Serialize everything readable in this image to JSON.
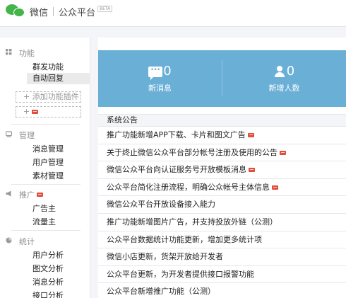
{
  "header": {
    "brand": "微信",
    "platform": "公众平台",
    "beta": "BETA"
  },
  "sidebar": {
    "sections": [
      {
        "title": "功能",
        "icon": "grid-icon",
        "items": [
          "群发功能",
          "自动回复"
        ]
      },
      {
        "title": "管理",
        "icon": "monitor-icon",
        "items": [
          "消息管理",
          "用户管理",
          "素材管理"
        ]
      },
      {
        "title": "推广",
        "icon": "megaphone-icon",
        "items": [
          "广告主",
          "流量主"
        ]
      },
      {
        "title": "统计",
        "icon": "chart-icon",
        "items": [
          "用户分析",
          "图文分析",
          "消息分析",
          "接口分析"
        ]
      }
    ],
    "add_plugin": "+ 添加功能插件",
    "add_small": "+",
    "active_item": "自动回复"
  },
  "stats": [
    {
      "value": "0",
      "label": "新消息",
      "icon": "message-icon"
    },
    {
      "value": "0",
      "label": "新增人数",
      "icon": "user-icon"
    }
  ],
  "announcements": {
    "title": "系统公告",
    "items": [
      {
        "text": "推广功能新增APP下载、卡片和图文广告",
        "new": true
      },
      {
        "text": "关于终止微信公众平台部分帐号注册及使用的公告",
        "new": true
      },
      {
        "text": "微信公众平台向认证服务号开放模板消息",
        "new": true
      },
      {
        "text": "公众平台简化注册流程，明确公众帐号主体信息",
        "new": true
      },
      {
        "text": "微信公众平台开放设备接入能力",
        "new": false
      },
      {
        "text": "推广功能新增图片广告，并支持投放外链（公测）",
        "new": false
      },
      {
        "text": "公众平台数据统计功能更新，增加更多统计项",
        "new": false
      },
      {
        "text": "微信小店更新，货架开放给开发者",
        "new": false
      },
      {
        "text": "公众平台更新，为开发者提供接口报警功能",
        "new": false
      },
      {
        "text": "公众平台新增推广功能（公测）",
        "new": false
      }
    ]
  }
}
